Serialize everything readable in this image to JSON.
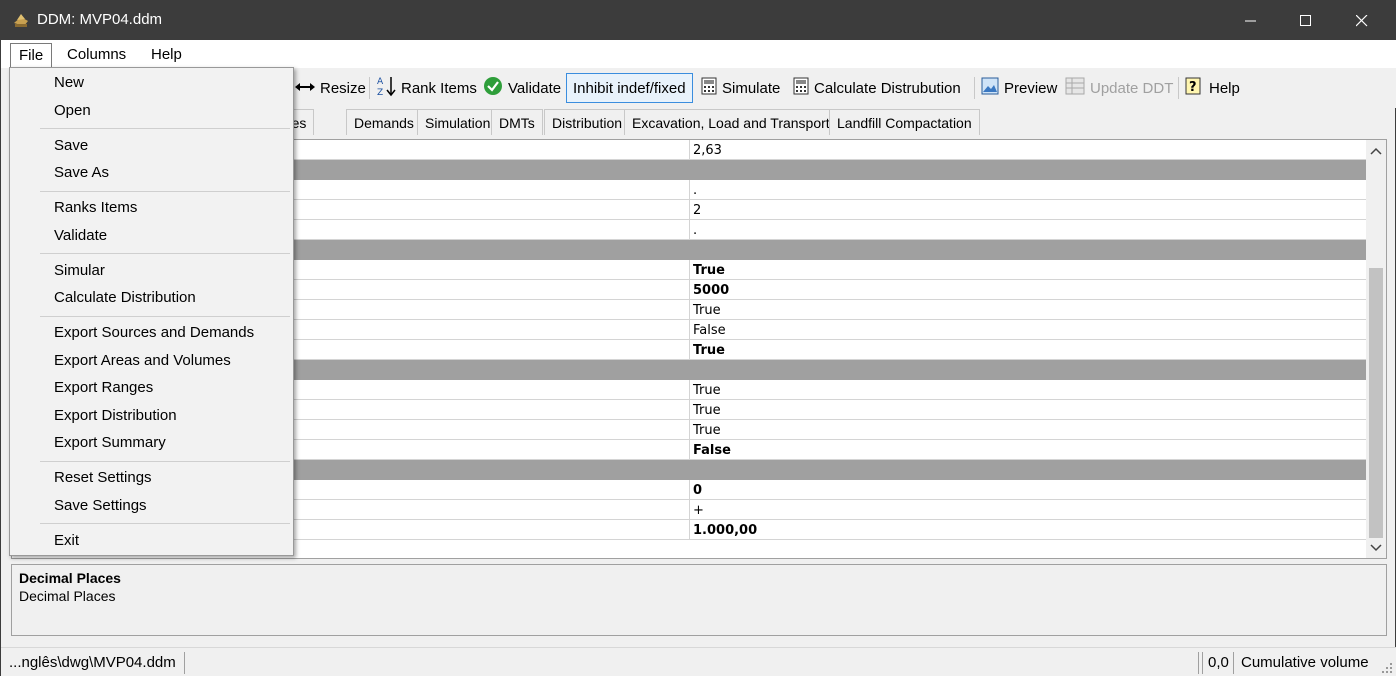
{
  "window": {
    "title": "DDM: MVP04.ddm"
  },
  "menubar": [
    {
      "label": "File",
      "active": true
    },
    {
      "label": "Columns"
    },
    {
      "label": "Help"
    }
  ],
  "toolbar": {
    "resize": "Resize",
    "rank_items": "Rank Items",
    "validate": "Validate",
    "inhibit": "Inhibit indef/fixed",
    "simulate": "Simulate",
    "calculate_distribution": "Calculate Distrubution",
    "preview": "Preview",
    "update_ddt": "Update DDT",
    "help": "Help"
  },
  "tabs": [
    "Sources",
    "Demands",
    "Simulation",
    "DMTs",
    "Distribution",
    "Excavation, Load and Transport",
    "Landfill Compactation"
  ],
  "grid": {
    "rows": [
      {
        "value": "2,63"
      },
      {
        "cat": true
      },
      {
        "value": "."
      },
      {
        "value": "2"
      },
      {
        "value": "."
      },
      {
        "cat": true
      },
      {
        "value": "True",
        "bold": true
      },
      {
        "value": "5000",
        "bold": true
      },
      {
        "value": "True"
      },
      {
        "value": "False"
      },
      {
        "value": "True",
        "bold": true
      },
      {
        "cat": true
      },
      {
        "value": "True"
      },
      {
        "value": "True"
      },
      {
        "value": "True"
      },
      {
        "value": "False",
        "bold": true
      },
      {
        "cat": true
      },
      {
        "value": "0",
        "bold": true
      },
      {
        "value": "+"
      },
      {
        "value": "1.000,00",
        "bold": true
      }
    ]
  },
  "description": {
    "heading": "Decimal Places",
    "text": "Decimal Places"
  },
  "statusbar": {
    "path": "...nglês\\dwg\\MVP04.ddm",
    "coord": "0,0",
    "mode": "Cumulative volume"
  },
  "file_menu": {
    "new": "New",
    "open": "Open",
    "save": "Save",
    "save_as": "Save As",
    "ranks_items": "Ranks Items",
    "validate": "Validate",
    "simular": "Simular",
    "calculate_distribution": "Calculate Distribution",
    "export_sources_demands": "Export Sources and Demands",
    "export_areas_volumes": "Export Areas and Volumes",
    "export_ranges": "Export Ranges",
    "export_distribution": "Export Distribution",
    "export_summary": "Export Summary",
    "reset_settings": "Reset Settings",
    "save_settings": "Save Settings",
    "exit": "Exit"
  },
  "colors": {
    "titlebar": "#3c3c3c",
    "category_row": "#a0a0a0",
    "pressed_border": "#3a8dde"
  }
}
